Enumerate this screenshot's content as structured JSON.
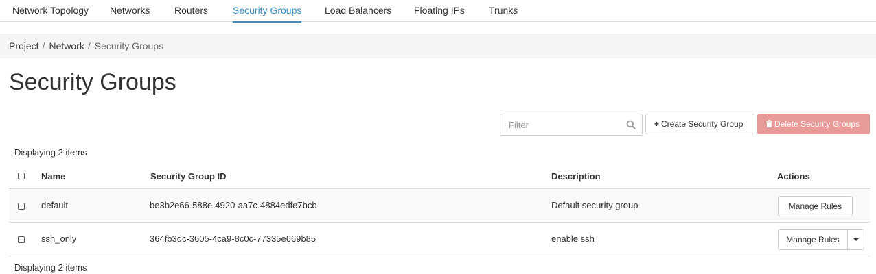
{
  "tabs": [
    {
      "label": "Network Topology",
      "active": false
    },
    {
      "label": "Networks",
      "active": false
    },
    {
      "label": "Routers",
      "active": false
    },
    {
      "label": "Security Groups",
      "active": true
    },
    {
      "label": "Load Balancers",
      "active": false
    },
    {
      "label": "Floating IPs",
      "active": false
    },
    {
      "label": "Trunks",
      "active": false
    }
  ],
  "breadcrumb": {
    "items": [
      "Project",
      "Network",
      "Security Groups"
    ],
    "separator": "/"
  },
  "page_title": "Security Groups",
  "toolbar": {
    "filter_placeholder": "Filter",
    "filter_value": "",
    "create_glyph": "+",
    "create_label": "Create Security Group",
    "delete_label": "Delete Security Groups",
    "delete_enabled": false
  },
  "table": {
    "count_text_top": "Displaying 2 items",
    "count_text_bottom": "Displaying 2 items",
    "columns": [
      "Name",
      "Security Group ID",
      "Description",
      "Actions"
    ],
    "rows": [
      {
        "name": "default",
        "id": "be3b2e66-588e-4920-aa7c-4884edfe7bcb",
        "description": "Default security group",
        "action": "Manage Rules",
        "has_dropdown": false
      },
      {
        "name": "ssh_only",
        "id": "364fb3dc-3605-4ca9-8c0c-77335e669b85",
        "description": "enable ssh",
        "action": "Manage Rules",
        "has_dropdown": true
      }
    ]
  },
  "colors": {
    "accent": "#3891c6",
    "danger_disabled": "#e79a98"
  },
  "icons": {
    "search": "search-icon",
    "delete": "trash-icon",
    "create": "plus-icon",
    "dropdown": "caret-down-icon"
  }
}
